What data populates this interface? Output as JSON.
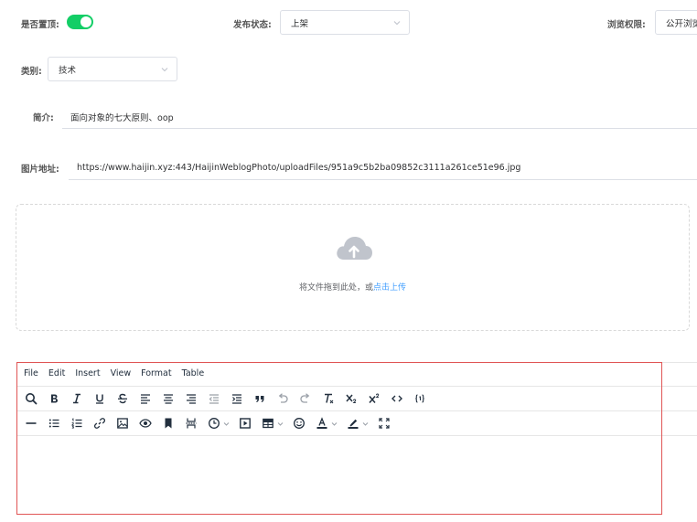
{
  "form": {
    "pinned": {
      "label": "是否置顶:",
      "on": true
    },
    "publish_status": {
      "label": "发布状态:",
      "value": "上架"
    },
    "view_permission": {
      "label": "浏览权限:",
      "value": "公开浏览"
    },
    "category": {
      "label": "类别:",
      "value": "技术"
    },
    "summary": {
      "label": "简介:",
      "value": "面向对象的七大原则、oop"
    },
    "image_url": {
      "label": "图片地址:",
      "value": "https://www.haijin.xyz:443/HaijinWeblogPhoto/uploadFiles/951a9c5b2ba09852c3111a261ce51e96.jpg"
    }
  },
  "upload": {
    "hint_prefix": "将文件拖到此处，或",
    "hint_link": "点击上传",
    "icon": "cloud-upload-icon"
  },
  "editor": {
    "menu": [
      "File",
      "Edit",
      "Insert",
      "View",
      "Format",
      "Table"
    ],
    "toolbar_row1": [
      "search-icon",
      "bold-icon",
      "italic-icon",
      "underline-icon",
      "strikethrough-icon",
      "align-left-icon",
      "align-center-icon",
      "align-right-icon",
      "outdent-icon",
      "indent-icon",
      "blockquote-icon",
      "undo-icon",
      "redo-icon",
      "clear-format-icon",
      "subscript-icon",
      "superscript-icon",
      "code-icon",
      "code-sample-icon"
    ],
    "toolbar_row2": [
      "horizontal-rule-icon",
      "bullet-list-icon",
      "numbered-list-icon",
      "link-icon",
      "image-icon",
      "preview-icon",
      "bookmark-icon",
      "page-break-icon",
      "insert-datetime-icon",
      "media-icon",
      "table-icon",
      "emoticons-icon",
      "text-color-icon",
      "highlight-color-icon",
      "fullscreen-icon"
    ]
  },
  "colors": {
    "switch_on": "#13ce66",
    "link": "#409eff",
    "editor_outline": "#e05555"
  }
}
